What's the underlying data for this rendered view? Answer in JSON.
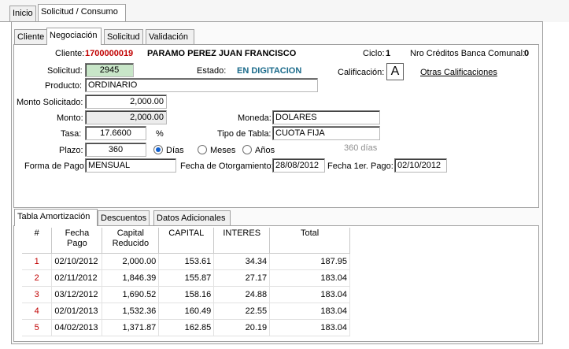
{
  "top_tabs": [
    {
      "label": "Inicio"
    },
    {
      "label": "Solicitud  / Consumo"
    }
  ],
  "sub_tabs": [
    {
      "label": "Cliente"
    },
    {
      "label": "Negociación"
    },
    {
      "label": "Solicitud"
    },
    {
      "label": "Validación"
    }
  ],
  "form": {
    "cliente_label": "Cliente:",
    "cliente_code": "1700000019",
    "cliente_name": "PARAMO PEREZ JUAN FRANCISCO",
    "ciclo_label": "Ciclo:",
    "ciclo_value": "1",
    "nro_creditos_label": "Nro Créditos Banca Comunal:",
    "nro_creditos_value": "0",
    "solicitud_label": "Solicitud:",
    "solicitud_value": "2945",
    "estado_label": "Estado:",
    "estado_value": "EN DIGITACION",
    "calificacion_label": "Calificación:",
    "calificacion_value": "A",
    "otras_calificaciones": "Otras Calificaciones",
    "producto_label": "Producto:",
    "producto_value": "ORDINARIO",
    "monto_solicitado_label": "Monto Solicitado:",
    "monto_solicitado_value": "2,000.00",
    "monto_label": "Monto:",
    "monto_value": "2,000.00",
    "moneda_label": "Moneda:",
    "moneda_value": "DOLARES",
    "tasa_label": "Tasa:",
    "tasa_value": "17.6600",
    "tasa_unit": "%",
    "tipo_tabla_label": "Tipo de Tabla:",
    "tipo_tabla_value": "CUOTA FIJA",
    "plazo_label": "Plazo:",
    "plazo_value": "360",
    "plazo_options": [
      "Días",
      "Meses",
      "Años"
    ],
    "plazo_hint": "360 días",
    "forma_pago_label": "Forma de Pago:",
    "forma_pago_value": "MENSUAL",
    "fecha_otorgamiento_label": "Fecha de Otorgamiento:",
    "fecha_otorgamiento_value": "28/08/2012",
    "fecha_primer_pago_label": "Fecha 1er. Pago:",
    "fecha_primer_pago_value": "02/10/2012"
  },
  "bottom_tabs": [
    {
      "label": "Tabla Amortización"
    },
    {
      "label": "Descuentos"
    },
    {
      "label": "Datos Adicionales"
    }
  ],
  "table": {
    "headers": [
      "#",
      "Fecha Pago",
      "Capital\nReducido",
      "CAPITAL",
      "INTERES",
      "Total"
    ],
    "rows": [
      [
        "1",
        "02/10/2012",
        "2,000.00",
        "153.61",
        "34.34",
        "187.95"
      ],
      [
        "2",
        "02/11/2012",
        "1,846.39",
        "155.87",
        "27.17",
        "183.04"
      ],
      [
        "3",
        "03/12/2012",
        "1,690.52",
        "158.16",
        "24.88",
        "183.04"
      ],
      [
        "4",
        "02/01/2013",
        "1,532.36",
        "160.49",
        "22.55",
        "183.04"
      ],
      [
        "5",
        "04/02/2013",
        "1,371.87",
        "162.85",
        "20.19",
        "183.04"
      ]
    ]
  },
  "colors": {
    "client_code": "#c00000",
    "estado": "#1a6a8a",
    "row_index": "#c00000",
    "solicitud_bg": "#c8e6c8"
  }
}
